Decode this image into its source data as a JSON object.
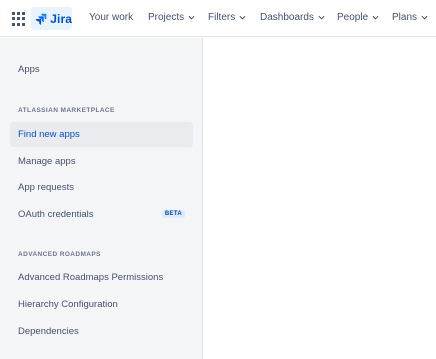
{
  "topnav": {
    "app_name": "Jira",
    "items": [
      {
        "label": "Your work",
        "dropdown": false
      },
      {
        "label": "Projects",
        "dropdown": true
      },
      {
        "label": "Filters",
        "dropdown": true
      },
      {
        "label": "Dashboards",
        "dropdown": true
      },
      {
        "label": "People",
        "dropdown": true
      },
      {
        "label": "Plans",
        "dropdown": true
      }
    ]
  },
  "sidebar": {
    "apps_label": "Apps",
    "section1": {
      "heading": "ATLASSIAN MARKETPLACE",
      "items": [
        {
          "label": "Find new apps",
          "active": true
        },
        {
          "label": "Manage apps",
          "active": false
        },
        {
          "label": "App requests",
          "active": false
        },
        {
          "label": "OAuth credentials",
          "active": false,
          "badge": "BETA"
        }
      ]
    },
    "section2": {
      "heading": "ADVANCED ROADMAPS",
      "items": [
        {
          "label": "Advanced Roadmaps Permissions"
        },
        {
          "label": "Hierarchy Configuration"
        },
        {
          "label": "Dependencies"
        }
      ]
    }
  },
  "colors": {
    "accent": "#0052cc",
    "sidebar_bg": "#f4f5f7",
    "active_item_bg": "#e9ebee",
    "text": "#42526e"
  }
}
